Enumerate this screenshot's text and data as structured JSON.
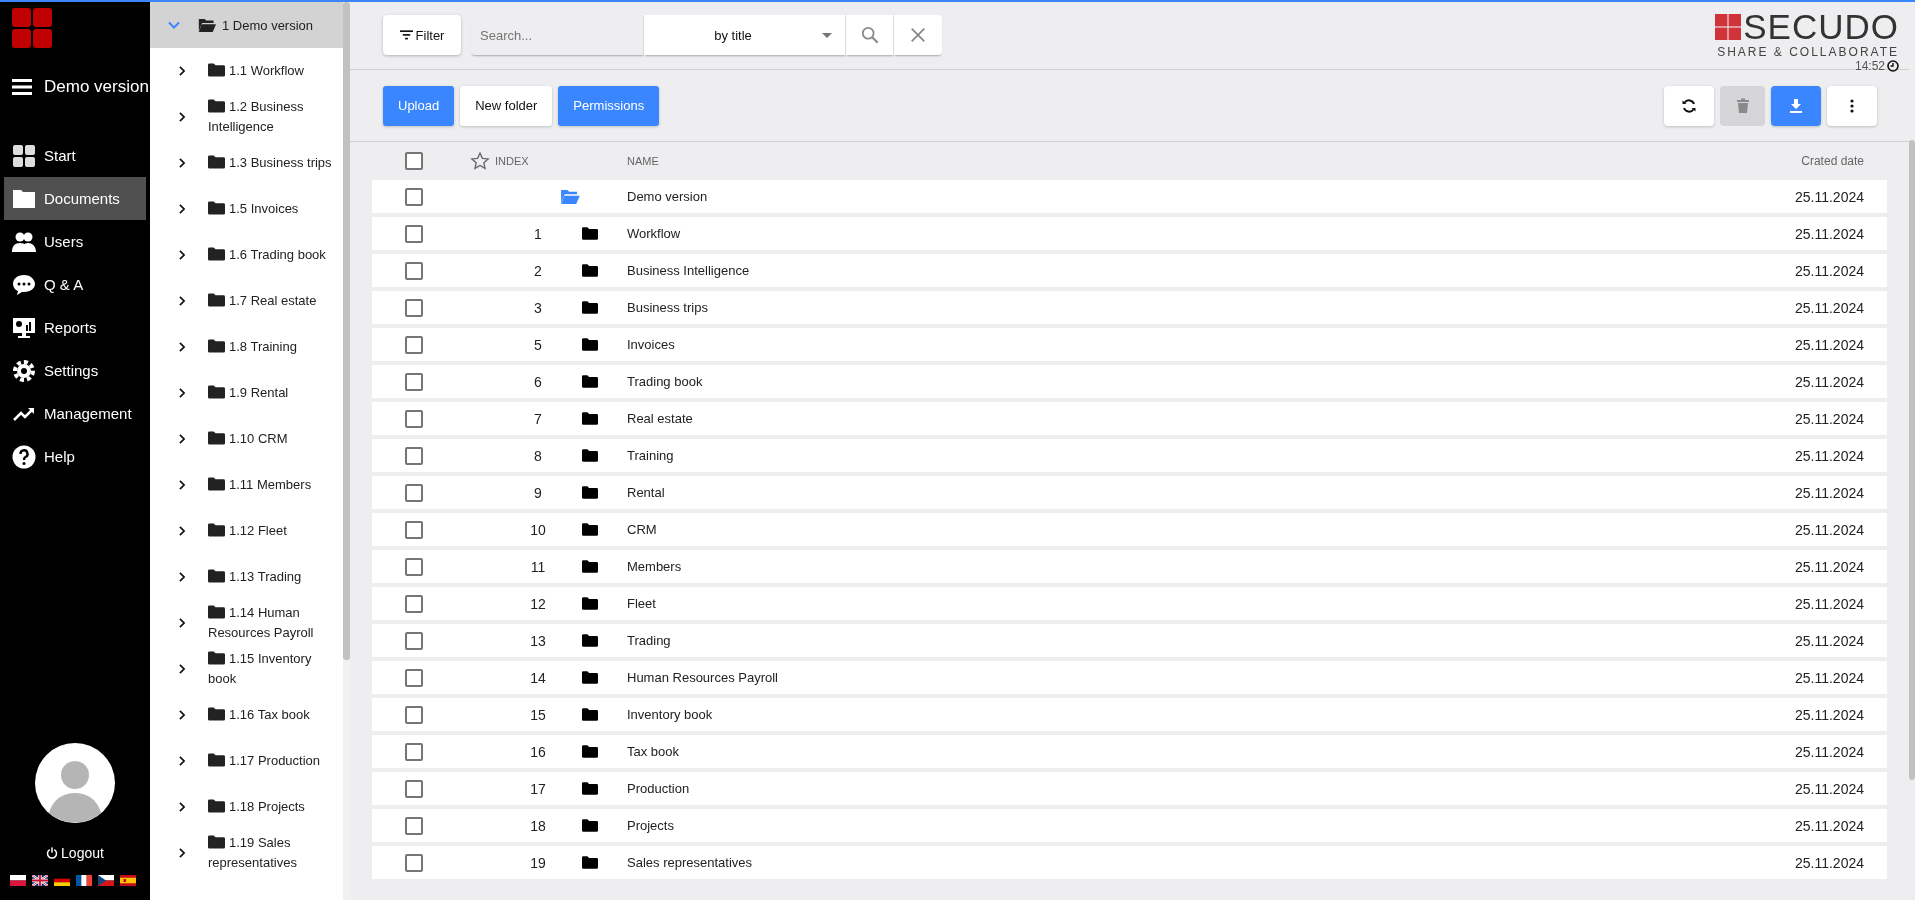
{
  "sidebar": {
    "menu_title": "Demo version",
    "items": [
      {
        "label": "Start",
        "kind": "grid",
        "selected": false
      },
      {
        "label": "Documents",
        "kind": "folder",
        "selected": true
      },
      {
        "label": "Users",
        "kind": "users",
        "selected": false
      },
      {
        "label": "Q & A",
        "kind": "chat",
        "selected": false
      },
      {
        "label": "Reports",
        "kind": "monitor",
        "selected": false
      },
      {
        "label": "Settings",
        "kind": "gear",
        "selected": false
      },
      {
        "label": "Management",
        "kind": "trend",
        "selected": false
      },
      {
        "label": "Help",
        "kind": "help",
        "selected": false
      }
    ],
    "logout": "Logout",
    "languages": [
      {
        "kind": "pl"
      },
      {
        "kind": "gb"
      },
      {
        "kind": "de"
      },
      {
        "kind": "fr"
      },
      {
        "kind": "cz"
      },
      {
        "kind": "es"
      }
    ]
  },
  "tree": {
    "label": "1 Demo version",
    "expanded": true,
    "selected": true,
    "children": [
      {
        "label": "1.1 Workflow",
        "expanded": false,
        "selected": false
      },
      {
        "label": "1.2 Business Intelligence",
        "expanded": false,
        "selected": false
      },
      {
        "label": "1.3 Business trips",
        "expanded": false,
        "selected": false
      },
      {
        "label": "1.5 Invoices",
        "expanded": false,
        "selected": false
      },
      {
        "label": "1.6 Trading book",
        "expanded": false,
        "selected": false
      },
      {
        "label": "1.7 Real estate",
        "expanded": false,
        "selected": false
      },
      {
        "label": "1.8 Training",
        "expanded": false,
        "selected": false
      },
      {
        "label": "1.9 Rental",
        "expanded": false,
        "selected": false
      },
      {
        "label": "1.10 CRM",
        "expanded": false,
        "selected": false
      },
      {
        "label": "1.11 Members",
        "expanded": false,
        "selected": false
      },
      {
        "label": "1.12 Fleet",
        "expanded": false,
        "selected": false
      },
      {
        "label": "1.13 Trading",
        "expanded": false,
        "selected": false
      },
      {
        "label": "1.14 Human Resources Payroll",
        "expanded": false,
        "selected": false
      },
      {
        "label": "1.15 Inventory book",
        "expanded": false,
        "selected": false
      },
      {
        "label": "1.16 Tax book",
        "expanded": false,
        "selected": false
      },
      {
        "label": "1.17 Production",
        "expanded": false,
        "selected": false
      },
      {
        "label": "1.18 Projects",
        "expanded": false,
        "selected": false
      },
      {
        "label": "1.19 Sales representatives",
        "expanded": false,
        "selected": false
      }
    ]
  },
  "toolbar": {
    "filter": "Filter",
    "search": {
      "placeholder": "Search..."
    },
    "search_by": "by title"
  },
  "brand": {
    "name": "SECUDO",
    "tagline": "SHARE & COLLABORATE",
    "time": "14:52"
  },
  "actions": [
    {
      "label": "Upload",
      "kind": "primary"
    },
    {
      "label": "New folder",
      "kind": "plain"
    },
    {
      "label": "Permissions",
      "kind": "primary"
    }
  ],
  "tools": [
    {
      "kind": "refresh",
      "disabled": false
    },
    {
      "kind": "delete",
      "disabled": true
    },
    {
      "kind": "download",
      "disabled": false
    },
    {
      "kind": "more",
      "disabled": false
    }
  ],
  "table": {
    "select_all": {
      "checked": false
    },
    "columns": [
      "INDEX",
      "NAME",
      "Crated date"
    ],
    "rows": [
      {
        "kind": "parent",
        "name": "Demo version",
        "date": "25.11.2024",
        "checked": false
      },
      {
        "kind": "folder",
        "index": "1",
        "name": "Workflow",
        "date": "25.11.2024",
        "checked": false
      },
      {
        "kind": "folder",
        "index": "2",
        "name": "Business Intelligence",
        "date": "25.11.2024",
        "checked": false
      },
      {
        "kind": "folder",
        "index": "3",
        "name": "Business trips",
        "date": "25.11.2024",
        "checked": false
      },
      {
        "kind": "folder",
        "index": "5",
        "name": "Invoices",
        "date": "25.11.2024",
        "checked": false
      },
      {
        "kind": "folder",
        "index": "6",
        "name": "Trading book",
        "date": "25.11.2024",
        "checked": false
      },
      {
        "kind": "folder",
        "index": "7",
        "name": "Real estate",
        "date": "25.11.2024",
        "checked": false
      },
      {
        "kind": "folder",
        "index": "8",
        "name": "Training",
        "date": "25.11.2024",
        "checked": false
      },
      {
        "kind": "folder",
        "index": "9",
        "name": "Rental",
        "date": "25.11.2024",
        "checked": false
      },
      {
        "kind": "folder",
        "index": "10",
        "name": "CRM",
        "date": "25.11.2024",
        "checked": false
      },
      {
        "kind": "folder",
        "index": "11",
        "name": "Members",
        "date": "25.11.2024",
        "checked": false
      },
      {
        "kind": "folder",
        "index": "12",
        "name": "Fleet",
        "date": "25.11.2024",
        "checked": false
      },
      {
        "kind": "folder",
        "index": "13",
        "name": "Trading",
        "date": "25.11.2024",
        "checked": false
      },
      {
        "kind": "folder",
        "index": "14",
        "name": "Human Resources Payroll",
        "date": "25.11.2024",
        "checked": false
      },
      {
        "kind": "folder",
        "index": "15",
        "name": "Inventory book",
        "date": "25.11.2024",
        "checked": false
      },
      {
        "kind": "folder",
        "index": "16",
        "name": "Tax book",
        "date": "25.11.2024",
        "checked": false
      },
      {
        "kind": "folder",
        "index": "17",
        "name": "Production",
        "date": "25.11.2024",
        "checked": false
      },
      {
        "kind": "folder",
        "index": "18",
        "name": "Projects",
        "date": "25.11.2024",
        "checked": false
      },
      {
        "kind": "folder",
        "index": "19",
        "name": "Sales representatives",
        "date": "25.11.2024",
        "checked": false
      }
    ]
  }
}
